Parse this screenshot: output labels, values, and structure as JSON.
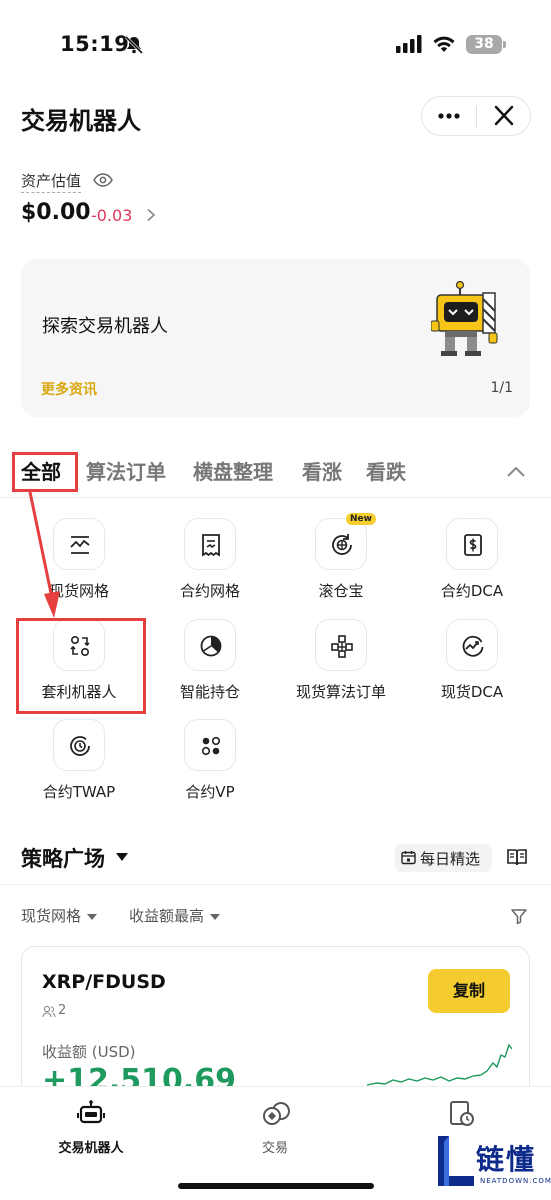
{
  "status_bar": {
    "time": "15:19",
    "battery": "38"
  },
  "header": {
    "title": "交易机器人"
  },
  "assets": {
    "label": "资产估值",
    "value": "$0.00",
    "change": "-0.03"
  },
  "banner": {
    "title": "探索交易机器人",
    "link": "更多资讯",
    "page": "1/1"
  },
  "tabs": [
    {
      "label": "全部"
    },
    {
      "label": "算法订单"
    },
    {
      "label": "横盘整理"
    },
    {
      "label": "看涨"
    },
    {
      "label": "看跌"
    }
  ],
  "products": [
    {
      "label": "现货网格",
      "icon": "grid-chart-icon"
    },
    {
      "label": "合约网格",
      "icon": "contract-doc-icon"
    },
    {
      "label": "滚仓宝",
      "icon": "rollover-icon",
      "badge": "New"
    },
    {
      "label": "合约DCA",
      "icon": "contract-dca-icon"
    },
    {
      "label": "套利机器人",
      "icon": "arbitrage-icon"
    },
    {
      "label": "智能持仓",
      "icon": "pie-chart-icon"
    },
    {
      "label": "现货算法订单",
      "icon": "algo-order-icon"
    },
    {
      "label": "现货DCA",
      "icon": "spot-dca-icon"
    },
    {
      "label": "合约TWAP",
      "icon": "twap-icon"
    },
    {
      "label": "合约VP",
      "icon": "vp-icon"
    }
  ],
  "plaza": {
    "title": "策略广场",
    "daily_label": "每日精选",
    "filter_type": "现货网格",
    "filter_sort": "收益额最高"
  },
  "card": {
    "pair": "XRP/FDUSD",
    "users": "2",
    "copy_label": "复制",
    "profit_label": "收益额 (USD)",
    "profit_value": "+12,510.69"
  },
  "bottom_nav": [
    {
      "label": "交易机器人",
      "icon": "robot-icon"
    },
    {
      "label": "交易",
      "icon": "trade-icon"
    },
    {
      "label": "",
      "icon": "history-icon"
    }
  ],
  "watermark": {
    "text": "链懂",
    "sub": "NEATDOWN.COM"
  },
  "colors": {
    "accent_yellow": "#f5cc2f",
    "link_gold": "#d9a80f",
    "loss_red": "#e0385a",
    "profit_green": "#1f9a5e",
    "highlight_red": "#e63f3f"
  }
}
